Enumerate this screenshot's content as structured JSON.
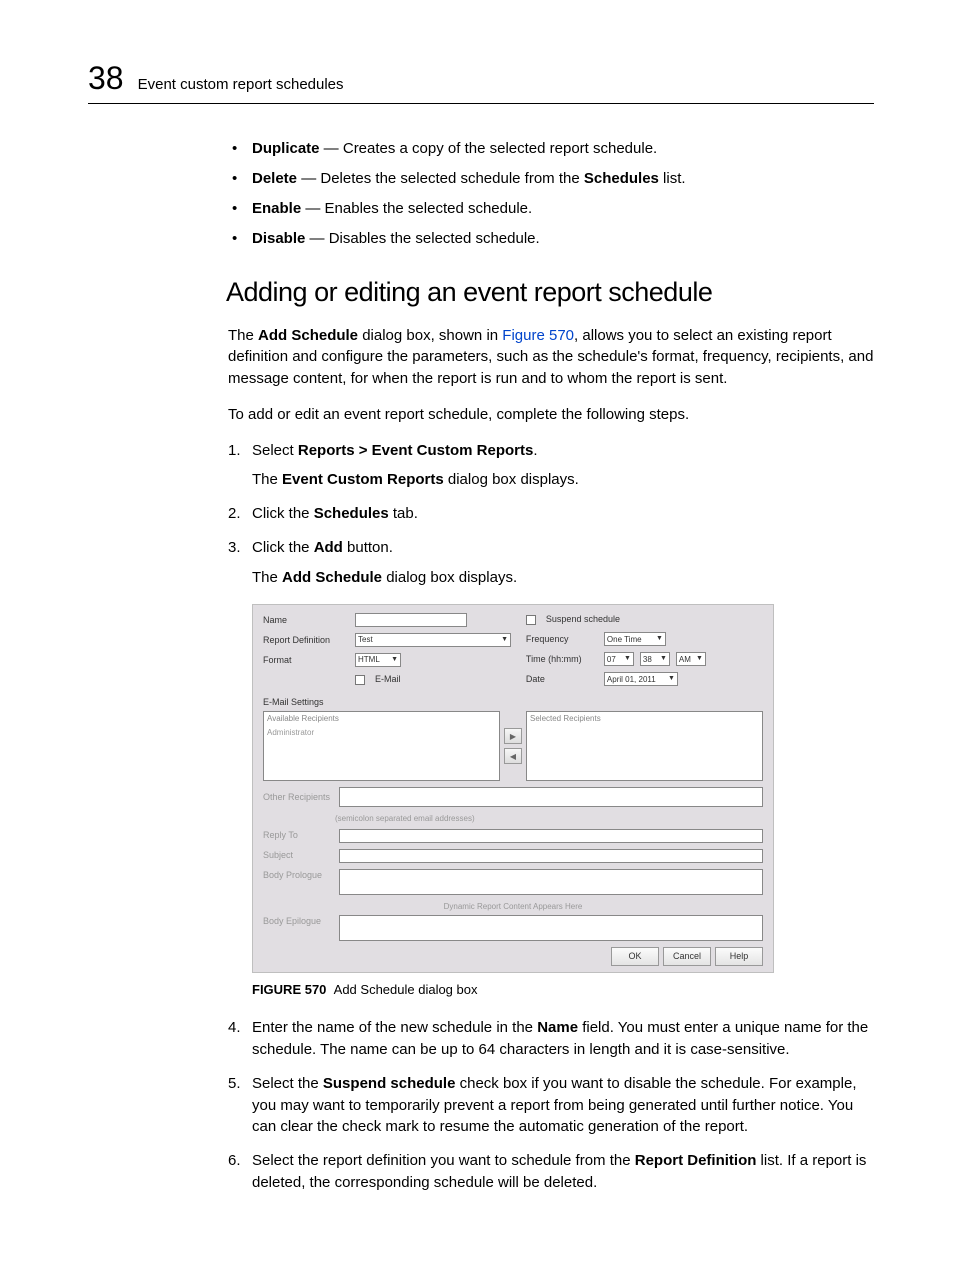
{
  "header": {
    "chapter_number": "38",
    "chapter_title": "Event custom report schedules"
  },
  "bullet_items": [
    {
      "term": "Duplicate",
      "sep": " — ",
      "desc": "Creates a copy of the selected report schedule."
    },
    {
      "term": "Delete",
      "sep": " — ",
      "desc_pre": "Deletes the selected schedule from the ",
      "bold_mid": "Schedules",
      "desc_post": " list."
    },
    {
      "term": "Enable",
      "sep": " — ",
      "desc": "Enables the selected schedule."
    },
    {
      "term": "Disable",
      "sep": " — ",
      "desc": "Disables the selected schedule."
    }
  ],
  "section_heading": "Adding or editing an event report schedule",
  "intro": {
    "p1_pre": "The ",
    "p1_b1": "Add Schedule",
    "p1_mid": " dialog box, shown in ",
    "p1_link": "Figure 570",
    "p1_post": ", allows you to select an existing report definition and configure the parameters, such as the schedule's format, frequency, recipients, and message content, for when the report is run and to whom the report is sent.",
    "p2": "To add or edit an event report schedule, complete the following steps."
  },
  "steps": {
    "s1_pre": "Select ",
    "s1_b": "Reports > Event Custom Reports",
    "s1_post": ".",
    "s1_sub_pre": "The ",
    "s1_sub_b": "Event Custom Reports",
    "s1_sub_post": " dialog box displays.",
    "s2_pre": "Click the ",
    "s2_b": "Schedules",
    "s2_post": " tab.",
    "s3_pre": "Click the ",
    "s3_b": "Add",
    "s3_post": " button.",
    "s3_sub_pre": "The ",
    "s3_sub_b": "Add Schedule",
    "s3_sub_post": " dialog box displays.",
    "s4_pre": "Enter the name of the new schedule in the ",
    "s4_b": "Name",
    "s4_post": " field. You must enter a unique name for the schedule. The name can be up to 64 characters in length and it is case-sensitive.",
    "s5_pre": "Select the ",
    "s5_b": "Suspend schedule",
    "s5_post": " check box if you want to disable the schedule. For example, you may want to temporarily prevent a report from being generated until further notice. You can clear the check mark to resume the automatic generation of the report.",
    "s6_pre": "Select the report definition you want to schedule from the ",
    "s6_b": "Report Definition",
    "s6_post": " list. If a report is deleted, the corresponding schedule will be deleted."
  },
  "figure": {
    "label": "FIGURE 570",
    "caption": "Add Schedule dialog box"
  },
  "dialog": {
    "labels": {
      "name": "Name",
      "report_def": "Report Definition",
      "format": "Format",
      "email_chk": "E-Mail",
      "suspend": "Suspend schedule",
      "frequency": "Frequency",
      "time": "Time (hh:mm)",
      "date": "Date",
      "email_settings": "E-Mail Settings",
      "avail": "Available Recipients",
      "selected": "Selected Recipients",
      "admin": "Administrator",
      "other": "Other Recipients",
      "other_note": "(semicolon separated email addresses)",
      "reply": "Reply To",
      "subject": "Subject",
      "prologue": "Body Prologue",
      "dyn_note": "Dynamic Report Content Appears Here",
      "epilogue": "Body Epilogue"
    },
    "values": {
      "report_def": "Test",
      "format": "HTML",
      "frequency": "One Time",
      "hour": "07",
      "min": "38",
      "ampm": "AM",
      "date": "April 01, 2011"
    },
    "buttons": {
      "ok": "OK",
      "cancel": "Cancel",
      "help": "Help"
    }
  }
}
